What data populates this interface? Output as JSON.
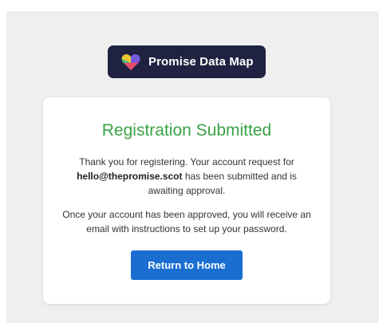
{
  "brand": {
    "name": "Promise Data Map",
    "icon": "heart-logo-icon",
    "colors": {
      "badge_bg": "#1f2240",
      "heart_top_left": "#f2c62f",
      "heart_top_right": "#8a4dd6",
      "heart_bottom": "#e84a6a",
      "heart_left": "#3cb878"
    }
  },
  "card": {
    "title": "Registration Submitted",
    "message_prefix": "Thank you for registering. Your account request for",
    "email": "hello@thepromise.scot",
    "message_suffix": "has been submitted and is awaiting approval.",
    "approval_note": "Once your account has been approved, you will receive an email with instructions to set up your password.",
    "button_label": "Return to Home"
  },
  "colors": {
    "accent_green": "#3aa345",
    "button_blue": "#1a6ed2",
    "page_background": "#efefef"
  }
}
